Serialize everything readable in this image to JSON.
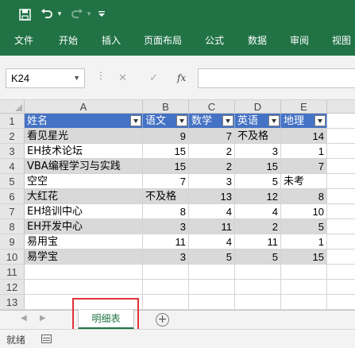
{
  "qat": {
    "save_icon": "save-icon",
    "undo_icon": "undo-icon",
    "redo_icon": "redo-icon"
  },
  "ribbon": {
    "tabs": [
      "文件",
      "开始",
      "插入",
      "页面布局",
      "公式",
      "数据",
      "审阅",
      "视图"
    ]
  },
  "formula_bar": {
    "name_box": "K24",
    "formula": ""
  },
  "grid": {
    "columns": [
      "A",
      "B",
      "C",
      "D",
      "E"
    ],
    "rows": [
      "1",
      "2",
      "3",
      "4",
      "5",
      "6",
      "7",
      "8",
      "9",
      "10",
      "11",
      "12",
      "13"
    ],
    "header": [
      "姓名",
      "语文",
      "数学",
      "英语",
      "地理"
    ],
    "data": [
      [
        "看见星光",
        "9",
        "7",
        "不及格",
        "14"
      ],
      [
        "EH技术论坛",
        "15",
        "2",
        "3",
        "1"
      ],
      [
        "VBA编程学习与实践",
        "15",
        "2",
        "15",
        "7"
      ],
      [
        "空空",
        "7",
        "3",
        "5",
        "未考"
      ],
      [
        "大红花",
        "不及格",
        "13",
        "12",
        "8"
      ],
      [
        "EH培训中心",
        "8",
        "4",
        "4",
        "10"
      ],
      [
        "EH开发中心",
        "3",
        "11",
        "2",
        "5"
      ],
      [
        "易用宝",
        "11",
        "4",
        "11",
        "1"
      ],
      [
        "易学宝",
        "3",
        "5",
        "5",
        "15"
      ]
    ],
    "colors": {
      "header_fill": "#4472c4",
      "band_fill": "#d9d9d9",
      "ribbon_green": "#217346"
    }
  },
  "sheets": {
    "active_tab": "明细表"
  },
  "status": {
    "text": "就绪"
  }
}
